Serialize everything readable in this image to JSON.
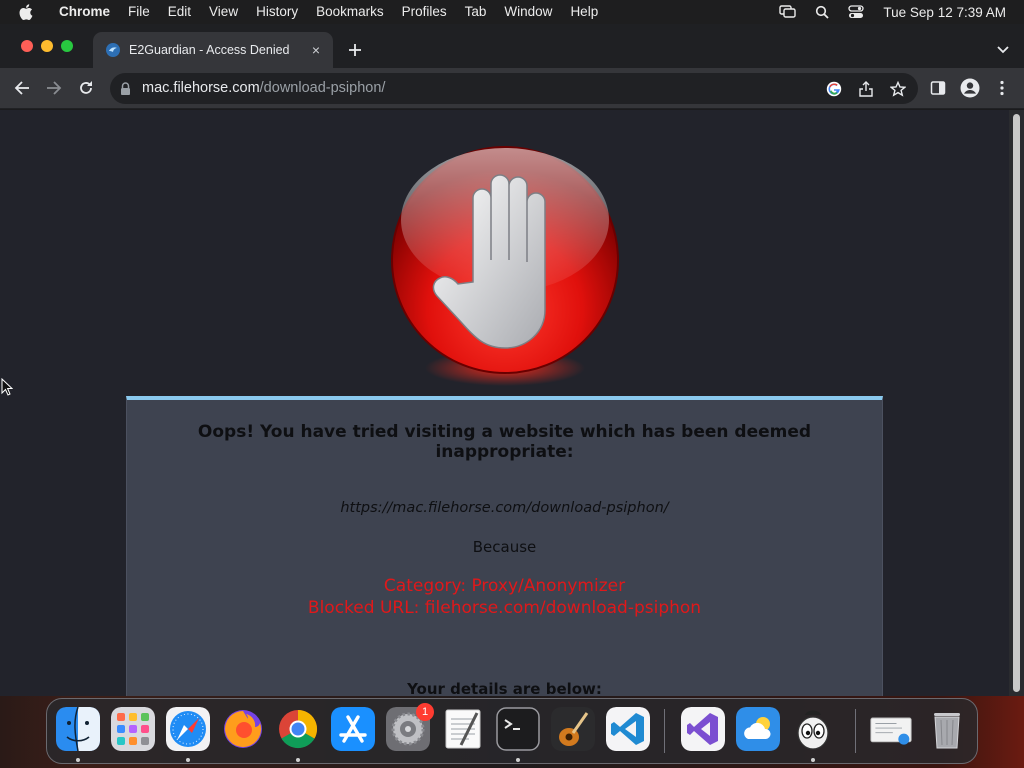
{
  "menubar": {
    "apple_icon": "apple-logo-icon",
    "items": [
      "Chrome",
      "File",
      "Edit",
      "View",
      "History",
      "Bookmarks",
      "Profiles",
      "Tab",
      "Window",
      "Help"
    ],
    "clock": "Tue Sep 12  7:39 AM",
    "status_icons": [
      "screen-mirroring-icon",
      "spotlight-search-icon",
      "control-center-icon"
    ]
  },
  "browser": {
    "tab": {
      "title": "E2Guardian - Access Denied",
      "close_glyph": "×"
    },
    "address": {
      "host": "mac.filehorse.com",
      "path": "/download-psiphon/"
    }
  },
  "page": {
    "headline": "Oops! You have tried visiting a website which has been deemed inappropriate:",
    "blocked_url": "https://mac.filehorse.com/download-psiphon/",
    "because": "Because",
    "reasons": [
      "Category: Proxy/Anonymizer",
      "Blocked URL: filehorse.com/download-psiphon"
    ],
    "details": "Your details are below:",
    "colors": {
      "panel": "#3e4350",
      "accent_bar": "#8ac9ee",
      "reason_text": "#e0181a"
    }
  },
  "dock": {
    "apps": [
      "Finder",
      "Launchpad",
      "Safari",
      "Firefox",
      "Google Chrome",
      "App Store",
      "System Settings",
      "TextEdit",
      "Terminal",
      "GarageBand",
      "Visual Studio Code",
      "Visual Studio",
      "Weather",
      "Cyberduck",
      "Mail Document",
      "Trash"
    ],
    "badges": {
      "System Settings": "1"
    }
  }
}
